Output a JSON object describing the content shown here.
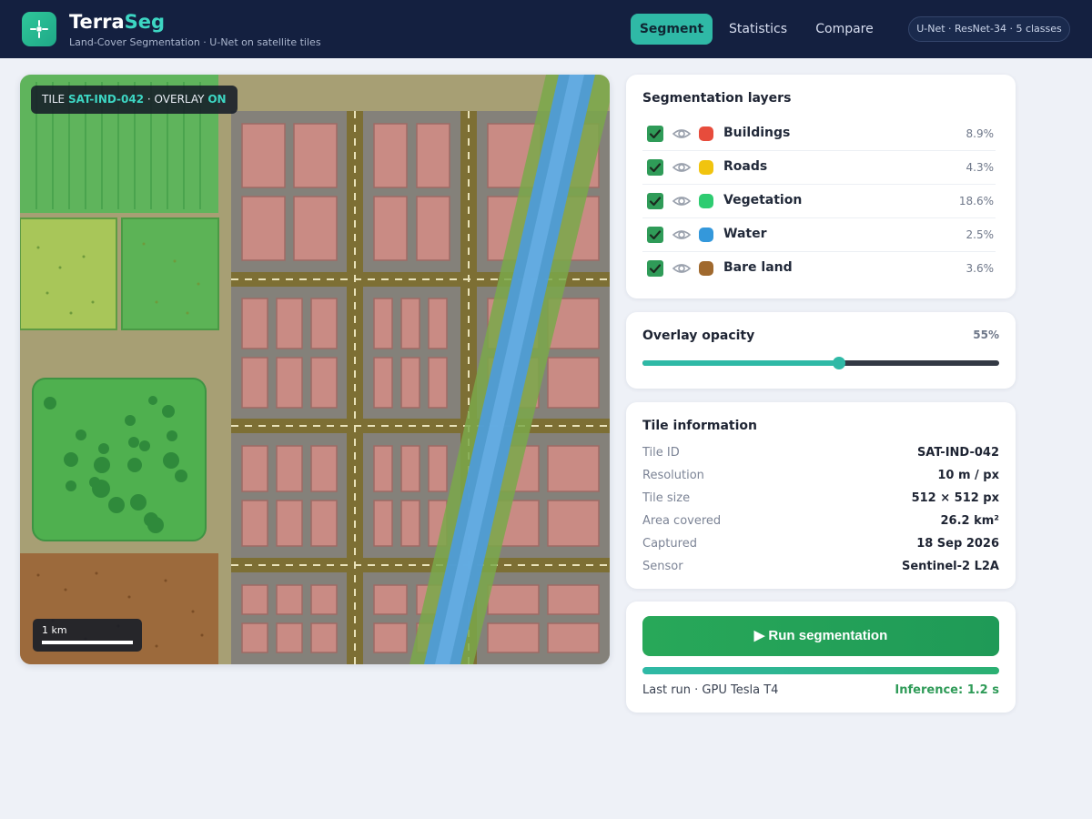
{
  "app": {
    "name_primary": "Terra",
    "name_accent": "Seg",
    "tagline": "Land-Cover Segmentation · U-Net on satellite tiles",
    "logo_icon": "crosshair-icon"
  },
  "nav": {
    "tabs": [
      {
        "label": "Segment",
        "active": true
      },
      {
        "label": "Statistics",
        "active": false
      },
      {
        "label": "Compare",
        "active": false
      }
    ],
    "model_label": "U-Net · ResNet-34 · 5 classes"
  },
  "map": {
    "tile_prefix": "TILE",
    "tile_id": "SAT-IND-042",
    "overlay_sep": "· OVERLAY",
    "overlay_state": "ON",
    "scale_label": "1 km"
  },
  "layers": {
    "title": "Segmentation layers",
    "items": [
      {
        "name": "Buildings",
        "pct": "8.9%",
        "color": "#e74c3c",
        "checked": true
      },
      {
        "name": "Roads",
        "pct": "4.3%",
        "color": "#f1c40f",
        "checked": true
      },
      {
        "name": "Vegetation",
        "pct": "18.6%",
        "color": "#2ecc71",
        "checked": true
      },
      {
        "name": "Water",
        "pct": "2.5%",
        "color": "#3498db",
        "checked": true
      },
      {
        "name": "Bare land",
        "pct": "3.6%",
        "color": "#a0692e",
        "checked": true
      }
    ]
  },
  "opacity": {
    "title": "Overlay opacity",
    "value_label": "55%",
    "value": 55
  },
  "tile_info": {
    "title": "Tile information",
    "rows": [
      {
        "key": "Tile ID",
        "value": "SAT-IND-042"
      },
      {
        "key": "Resolution",
        "value": "10 m / px"
      },
      {
        "key": "Tile size",
        "value": "512 × 512 px"
      },
      {
        "key": "Area covered",
        "value": "26.2 km²"
      },
      {
        "key": "Captured",
        "value": "18 Sep 2026"
      },
      {
        "key": "Sensor",
        "value": "Sentinel-2 L2A"
      }
    ]
  },
  "run": {
    "button_label": "▶ Run segmentation",
    "progress": 100,
    "last_run": "Last run · GPU Tesla T4",
    "inference": "Inference: 1.2 s"
  },
  "colors": {
    "header_bg": "#142040",
    "accent": "#2fb9a6",
    "success": "#2f9b58"
  }
}
